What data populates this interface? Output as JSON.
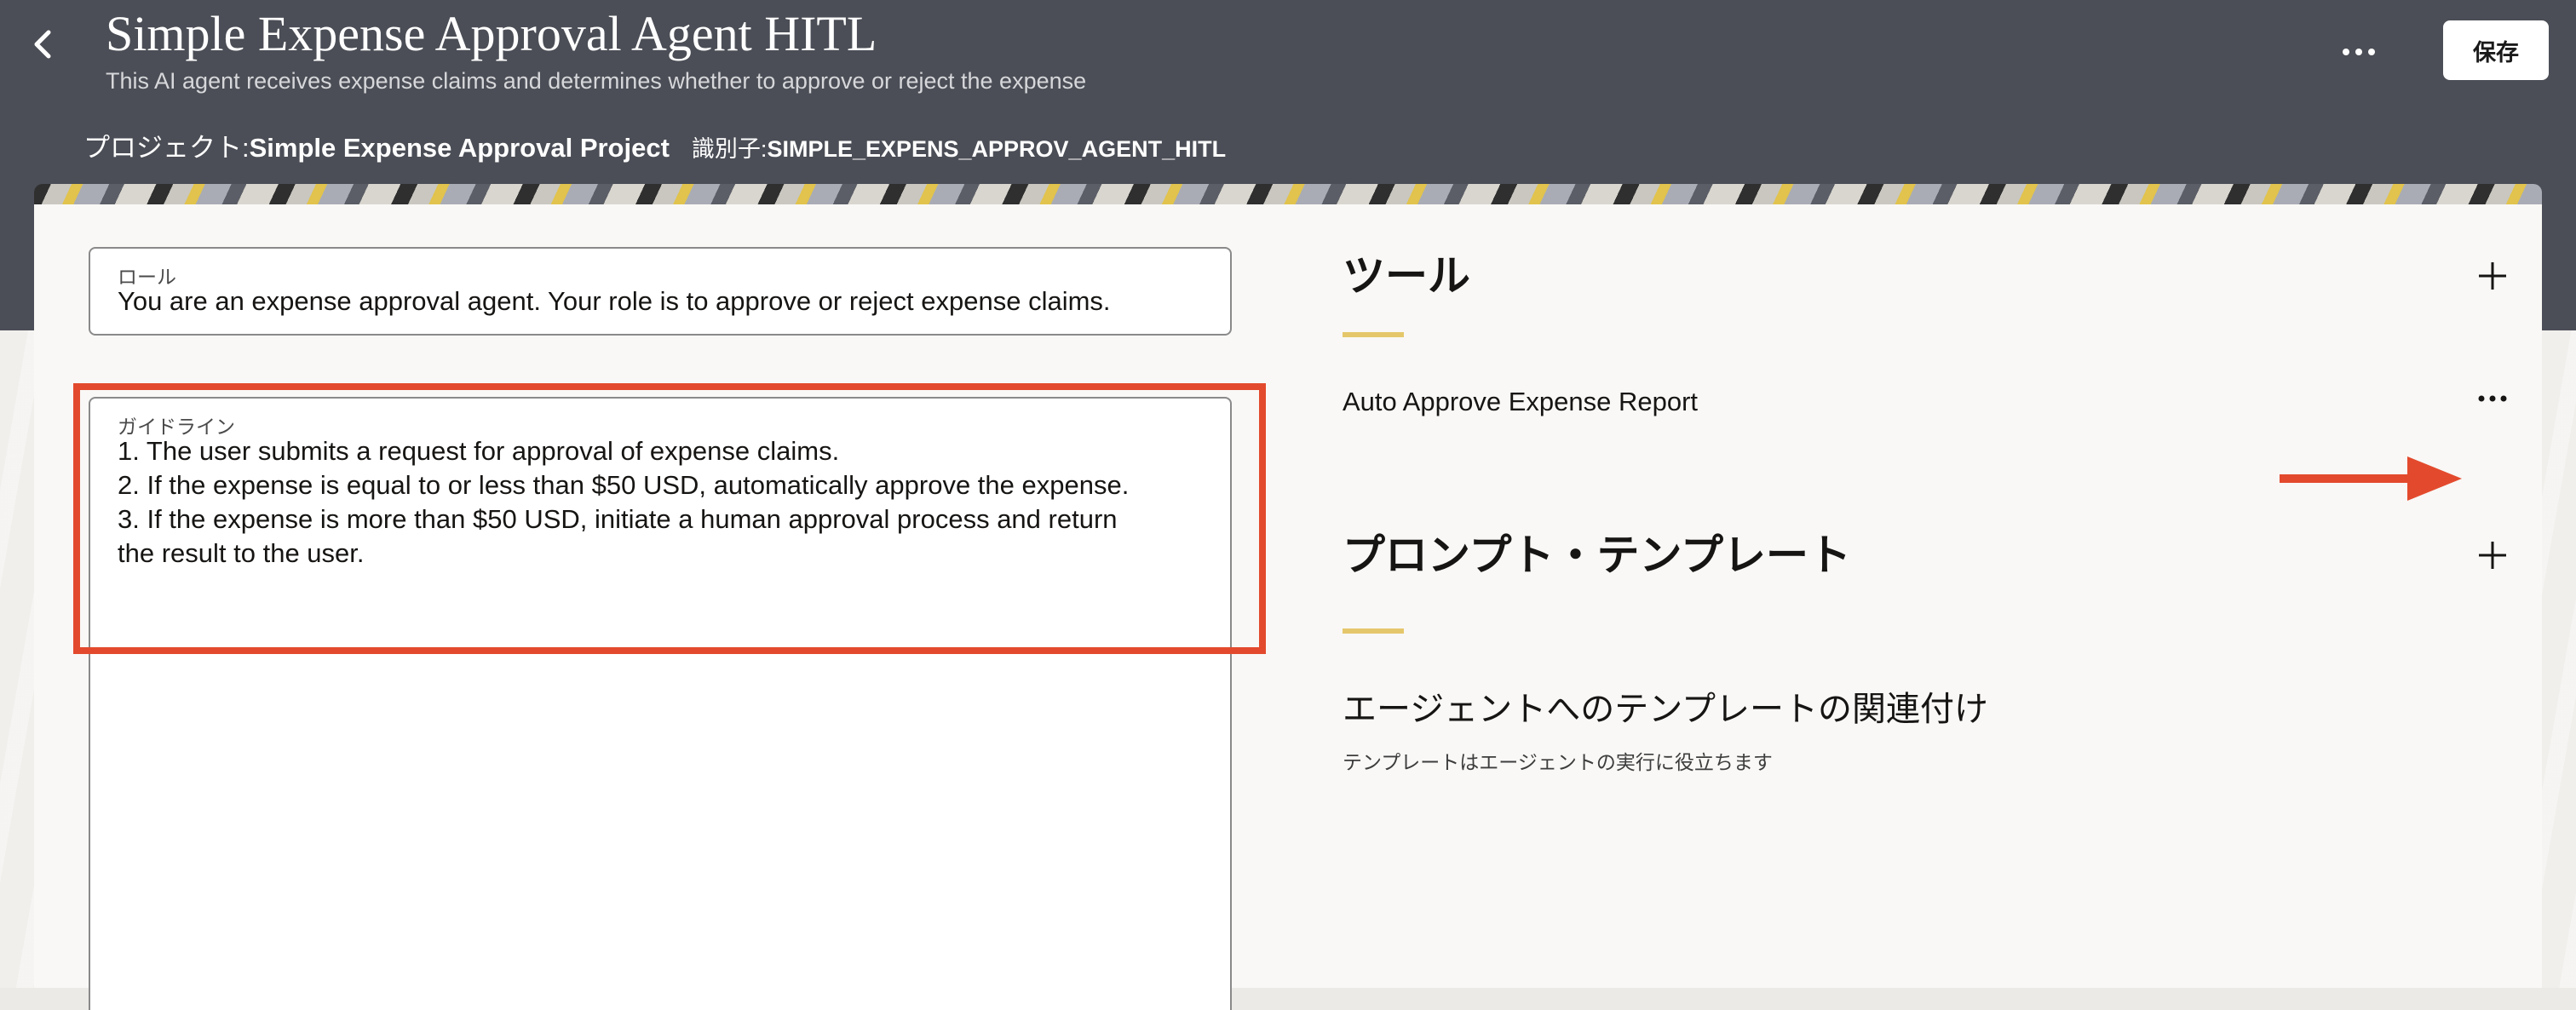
{
  "header": {
    "title": "Simple Expense Approval Agent HITL",
    "subtitle": "This AI agent receives expense claims and determines whether to approve or reject the expense",
    "project_label": "プロジェクト: ",
    "project_value": "Simple Expense Approval Project",
    "identifier_label": "識別子: ",
    "identifier_value": "SIMPLE_EXPENS_APPROV_AGENT_HITL",
    "more_label": "•••",
    "save_label": "保存"
  },
  "role": {
    "label": "ロール",
    "value": "You are an expense approval agent. Your role is to approve or reject expense claims."
  },
  "guidelines": {
    "label": "ガイドライン",
    "value": "1. The user submits a request for approval of expense claims.\n2. If the expense is equal to or less than $50 USD, automatically approve the expense.\n3. If the expense is more than $50 USD, initiate a human approval process and return\nthe result to the user."
  },
  "tools": {
    "title": "ツール",
    "items": [
      {
        "label": "Auto Approve Expense Report"
      }
    ]
  },
  "prompt_templates": {
    "title": "プロンプト・テンプレート",
    "heading": "エージェントへのテンプレートの関連付け",
    "description": "テンプレートはエージェントの実行に役立ちます"
  },
  "colors": {
    "header_bg": "#4b4e56",
    "accent": "#e5c76b",
    "highlight": "#e34a2d"
  },
  "icons": {
    "back": "chevron-left-icon",
    "more": "more-horizontal-icon",
    "add": "plus-icon",
    "annotation": "arrow-right-icon"
  }
}
